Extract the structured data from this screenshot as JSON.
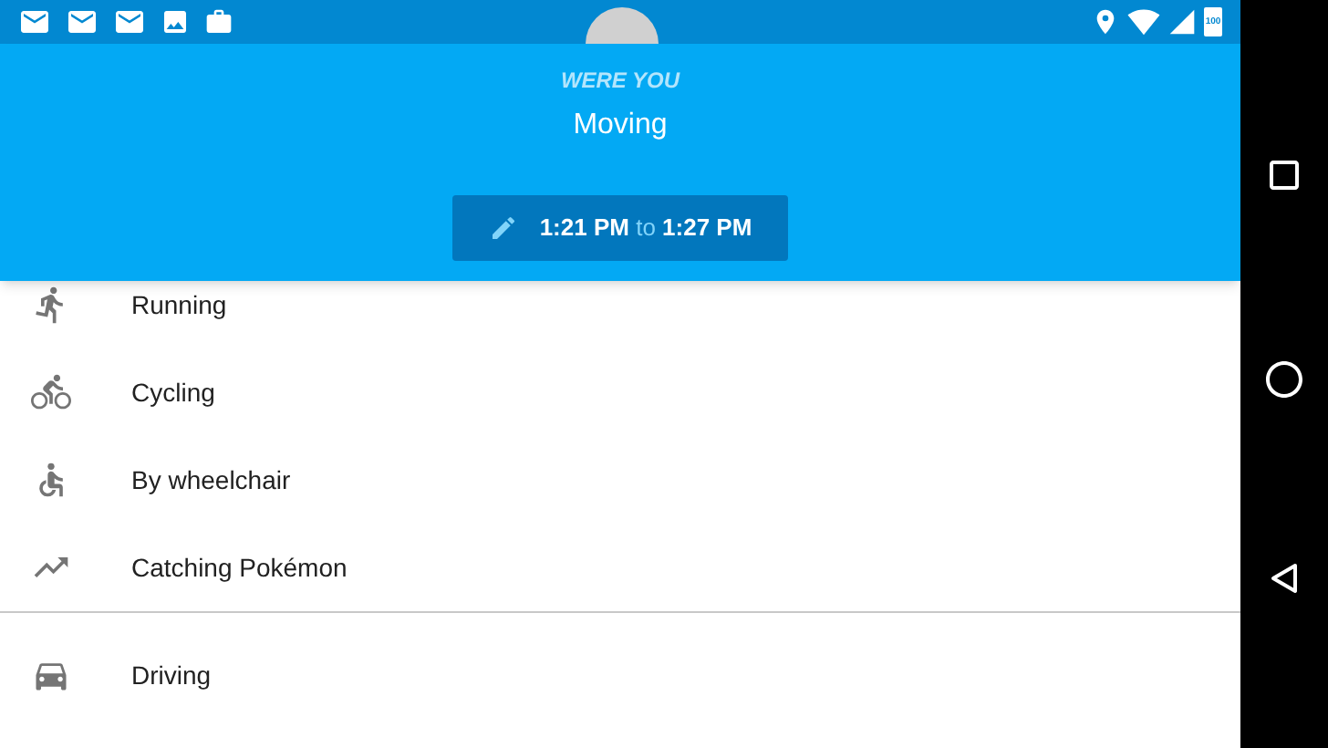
{
  "status_bar": {
    "battery": "100"
  },
  "header": {
    "prompt": "WERE YOU",
    "activity": "Moving",
    "time_range": {
      "start": "1:21 PM",
      "separator": "to",
      "end": "1:27 PM"
    }
  },
  "groups": [
    {
      "items": [
        {
          "label": "Running"
        },
        {
          "label": "Cycling"
        },
        {
          "label": "By wheelchair"
        },
        {
          "label": "Catching Pokémon"
        }
      ]
    },
    {
      "items": [
        {
          "label": "Driving"
        }
      ]
    }
  ]
}
